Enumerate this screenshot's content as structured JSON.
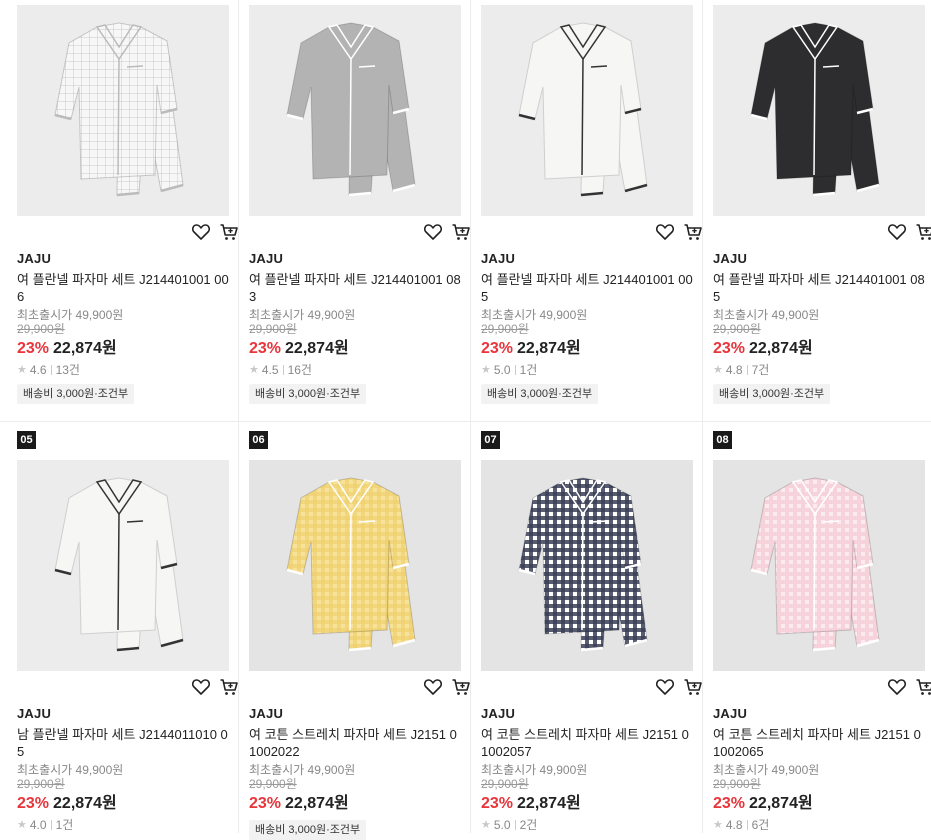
{
  "products": [
    {
      "rank": "",
      "bg": "#ececec",
      "color": "#f7f7f7",
      "trim": "#bbbbbb",
      "pattern": "check-light",
      "brand": "JAJU",
      "name": "여 플란넬 파자마 세트 J214401001 006",
      "launch": "최초출시가 49,900원",
      "original": "29,900원",
      "discount": "23%",
      "price": "22,874원",
      "rating": "4.6",
      "reviews": "13건",
      "shipping": "배송비 3,000원·조건부",
      "icons": {
        "wish": "heart-icon",
        "cart": "cart-icon"
      }
    },
    {
      "rank": "",
      "bg": "#ececec",
      "color": "#b3b3b3",
      "trim": "#ffffff",
      "pattern": "solid",
      "brand": "JAJU",
      "name": "여 플란넬 파자마 세트 J214401001 083",
      "launch": "최초출시가 49,900원",
      "original": "29,900원",
      "discount": "23%",
      "price": "22,874원",
      "rating": "4.5",
      "reviews": "16건",
      "shipping": "배송비 3,000원·조건부",
      "icons": {
        "wish": "heart-icon",
        "cart": "cart-icon"
      }
    },
    {
      "rank": "",
      "bg": "#ececec",
      "color": "#f6f6f4",
      "trim": "#333333",
      "pattern": "solid",
      "brand": "JAJU",
      "name": "여 플란넬 파자마 세트 J214401001 005",
      "launch": "최초출시가 49,900원",
      "original": "29,900원",
      "discount": "23%",
      "price": "22,874원",
      "rating": "5.0",
      "reviews": "1건",
      "shipping": "배송비 3,000원·조건부",
      "icons": {
        "wish": "heart-icon",
        "cart": "cart-icon"
      }
    },
    {
      "rank": "",
      "bg": "#ececec",
      "color": "#2d2d2f",
      "trim": "#ffffff",
      "pattern": "solid",
      "brand": "JAJU",
      "name": "여 플란넬 파자마 세트 J214401001 085",
      "launch": "최초출시가 49,900원",
      "original": "29,900원",
      "discount": "23%",
      "price": "22,874원",
      "rating": "4.8",
      "reviews": "7건",
      "shipping": "배송비 3,000원·조건부",
      "icons": {
        "wish": "heart-icon",
        "cart": "cart-icon"
      }
    },
    {
      "rank": "05",
      "bg": "#ececec",
      "color": "#f6f6f4",
      "trim": "#333333",
      "pattern": "solid",
      "brand": "JAJU",
      "name": "남 플란넬 파자마 세트 J2144011010 05",
      "launch": "최초출시가 49,900원",
      "original": "29,900원",
      "discount": "23%",
      "price": "22,874원",
      "rating": "4.0",
      "reviews": "1건",
      "shipping": "",
      "icons": {
        "wish": "heart-icon",
        "cart": "cart-icon"
      }
    },
    {
      "rank": "06",
      "bg": "#e4e4e4",
      "color": "#f7e29a",
      "trim": "#ffffff",
      "pattern": "check-yellow",
      "brand": "JAJU",
      "name": "여 코튼 스트레치 파자마 세트 J2151 01002022",
      "launch": "최초출시가 49,900원",
      "original": "29,900원",
      "discount": "23%",
      "price": "22,874원",
      "rating": "",
      "reviews": "",
      "shipping": "배송비 3,000원·조건부",
      "icons": {
        "wish": "heart-icon",
        "cart": "cart-icon"
      }
    },
    {
      "rank": "07",
      "bg": "#e4e4e4",
      "color": "#3b3f57",
      "trim": "#ffffff",
      "pattern": "check-navy",
      "brand": "JAJU",
      "name": "여 코튼 스트레치 파자마 세트 J2151 01002057",
      "launch": "최초출시가 49,900원",
      "original": "29,900원",
      "discount": "23%",
      "price": "22,874원",
      "rating": "5.0",
      "reviews": "2건",
      "shipping": "",
      "icons": {
        "wish": "heart-icon",
        "cart": "cart-icon"
      }
    },
    {
      "rank": "08",
      "bg": "#e4e4e4",
      "color": "#f6d3da",
      "trim": "#ffffff",
      "pattern": "check-pink",
      "brand": "JAJU",
      "name": "여 코튼 스트레치 파자마 세트 J2151 01002065",
      "launch": "최초출시가 49,900원",
      "original": "29,900원",
      "discount": "23%",
      "price": "22,874원",
      "rating": "4.8",
      "reviews": "6건",
      "shipping": "",
      "icons": {
        "wish": "heart-icon",
        "cart": "cart-icon"
      }
    }
  ]
}
